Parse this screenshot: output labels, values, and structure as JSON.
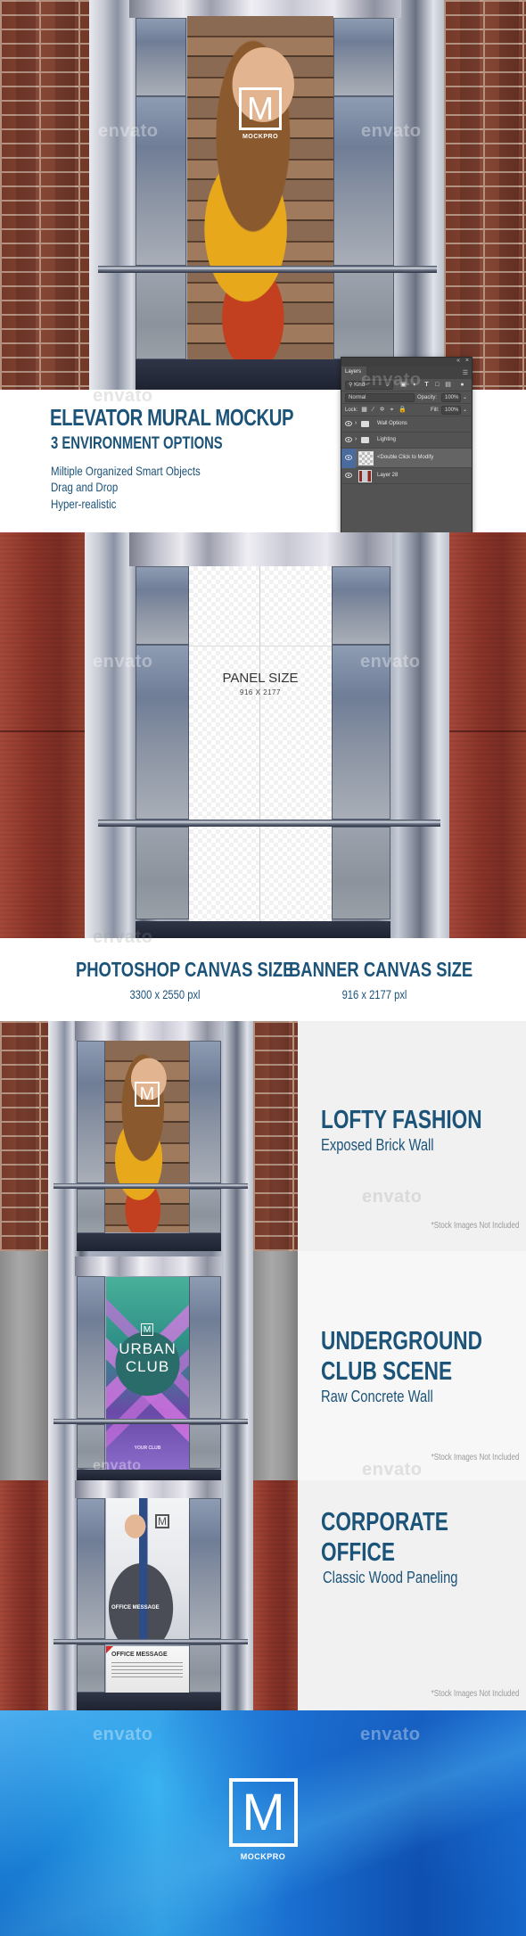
{
  "hero": {
    "watermark_left": "envato",
    "watermark_right": "envato",
    "mural_logo": {
      "letter": "M",
      "caption": "MOCKPRO"
    }
  },
  "intro": {
    "watermark": "envato",
    "title": "ELEVATOR MURAL MOCKUP",
    "subtitle": "3 ENVIRONMENT OPTIONS",
    "features": [
      "Miltiple Organized Smart Objects",
      "Drag and Drop",
      "Hyper-realistic"
    ]
  },
  "layers_panel": {
    "tab_label": "Layers",
    "filter_label": "Kind",
    "blend_mode": "Normal",
    "opacity_label": "Opacity:",
    "opacity_value": "100%",
    "lock_label": "Lock:",
    "fill_label": "Fill:",
    "fill_value": "100%",
    "watermark": "envato",
    "layers": [
      {
        "name": "Wall Options",
        "type": "folder",
        "selected": false
      },
      {
        "name": "Lighting",
        "type": "folder",
        "selected": false
      },
      {
        "name": "<Double Click to Modify",
        "type": "smart-object",
        "selected": true
      },
      {
        "name": "Layer 28",
        "type": "image",
        "selected": false
      }
    ]
  },
  "panel_preview": {
    "watermark_left": "envato",
    "watermark_right": "envato",
    "panel_label": "PANEL SIZE",
    "panel_dims": "916 X 2177"
  },
  "canvas_sizes": [
    {
      "label": "PHOTOSHOP CANVAS SIZE",
      "value": "3300 x 2550 pxl"
    },
    {
      "label": "BANNER CANVAS SIZE",
      "value": "916 x 2177 pxl"
    }
  ],
  "environments": [
    {
      "title_lines": [
        "LOFTY FASHION"
      ],
      "subtitle": "Exposed Brick Wall",
      "disclaimer": "*Stock Images Not Included",
      "watermark": "envato",
      "wall": "brick"
    },
    {
      "title_lines": [
        "UNDERGROUND",
        "CLUB SCENE"
      ],
      "subtitle": "Raw Concrete Wall",
      "disclaimer": "*Stock Images Not Included",
      "watermark": "envato",
      "wall": "concrete",
      "poster": {
        "title_line1": "URBAN",
        "title_line2": "CLUB",
        "tagline": "YOUR CLUB"
      }
    },
    {
      "title_lines": [
        "CORPORATE",
        "OFFICE"
      ],
      "subtitle": "Classic Wood Paneling",
      "disclaimer": "*Stock Images Not Included",
      "watermark": "envato",
      "wall": "wood",
      "poster": {
        "overlay_heading": "OFFICE MESSAGE",
        "card_heading": "OFFICE MESSAGE"
      }
    }
  ],
  "footer": {
    "watermark_left": "envato",
    "watermark_right": "envato",
    "logo_letter": "M",
    "brand_name": "MOCKPRO"
  },
  "colors": {
    "heading_blue": "#1c5379",
    "ps_panel": "#535353",
    "ps_selected_eye": "#4a6b9e",
    "banner_blue": "#1a6fd0"
  }
}
